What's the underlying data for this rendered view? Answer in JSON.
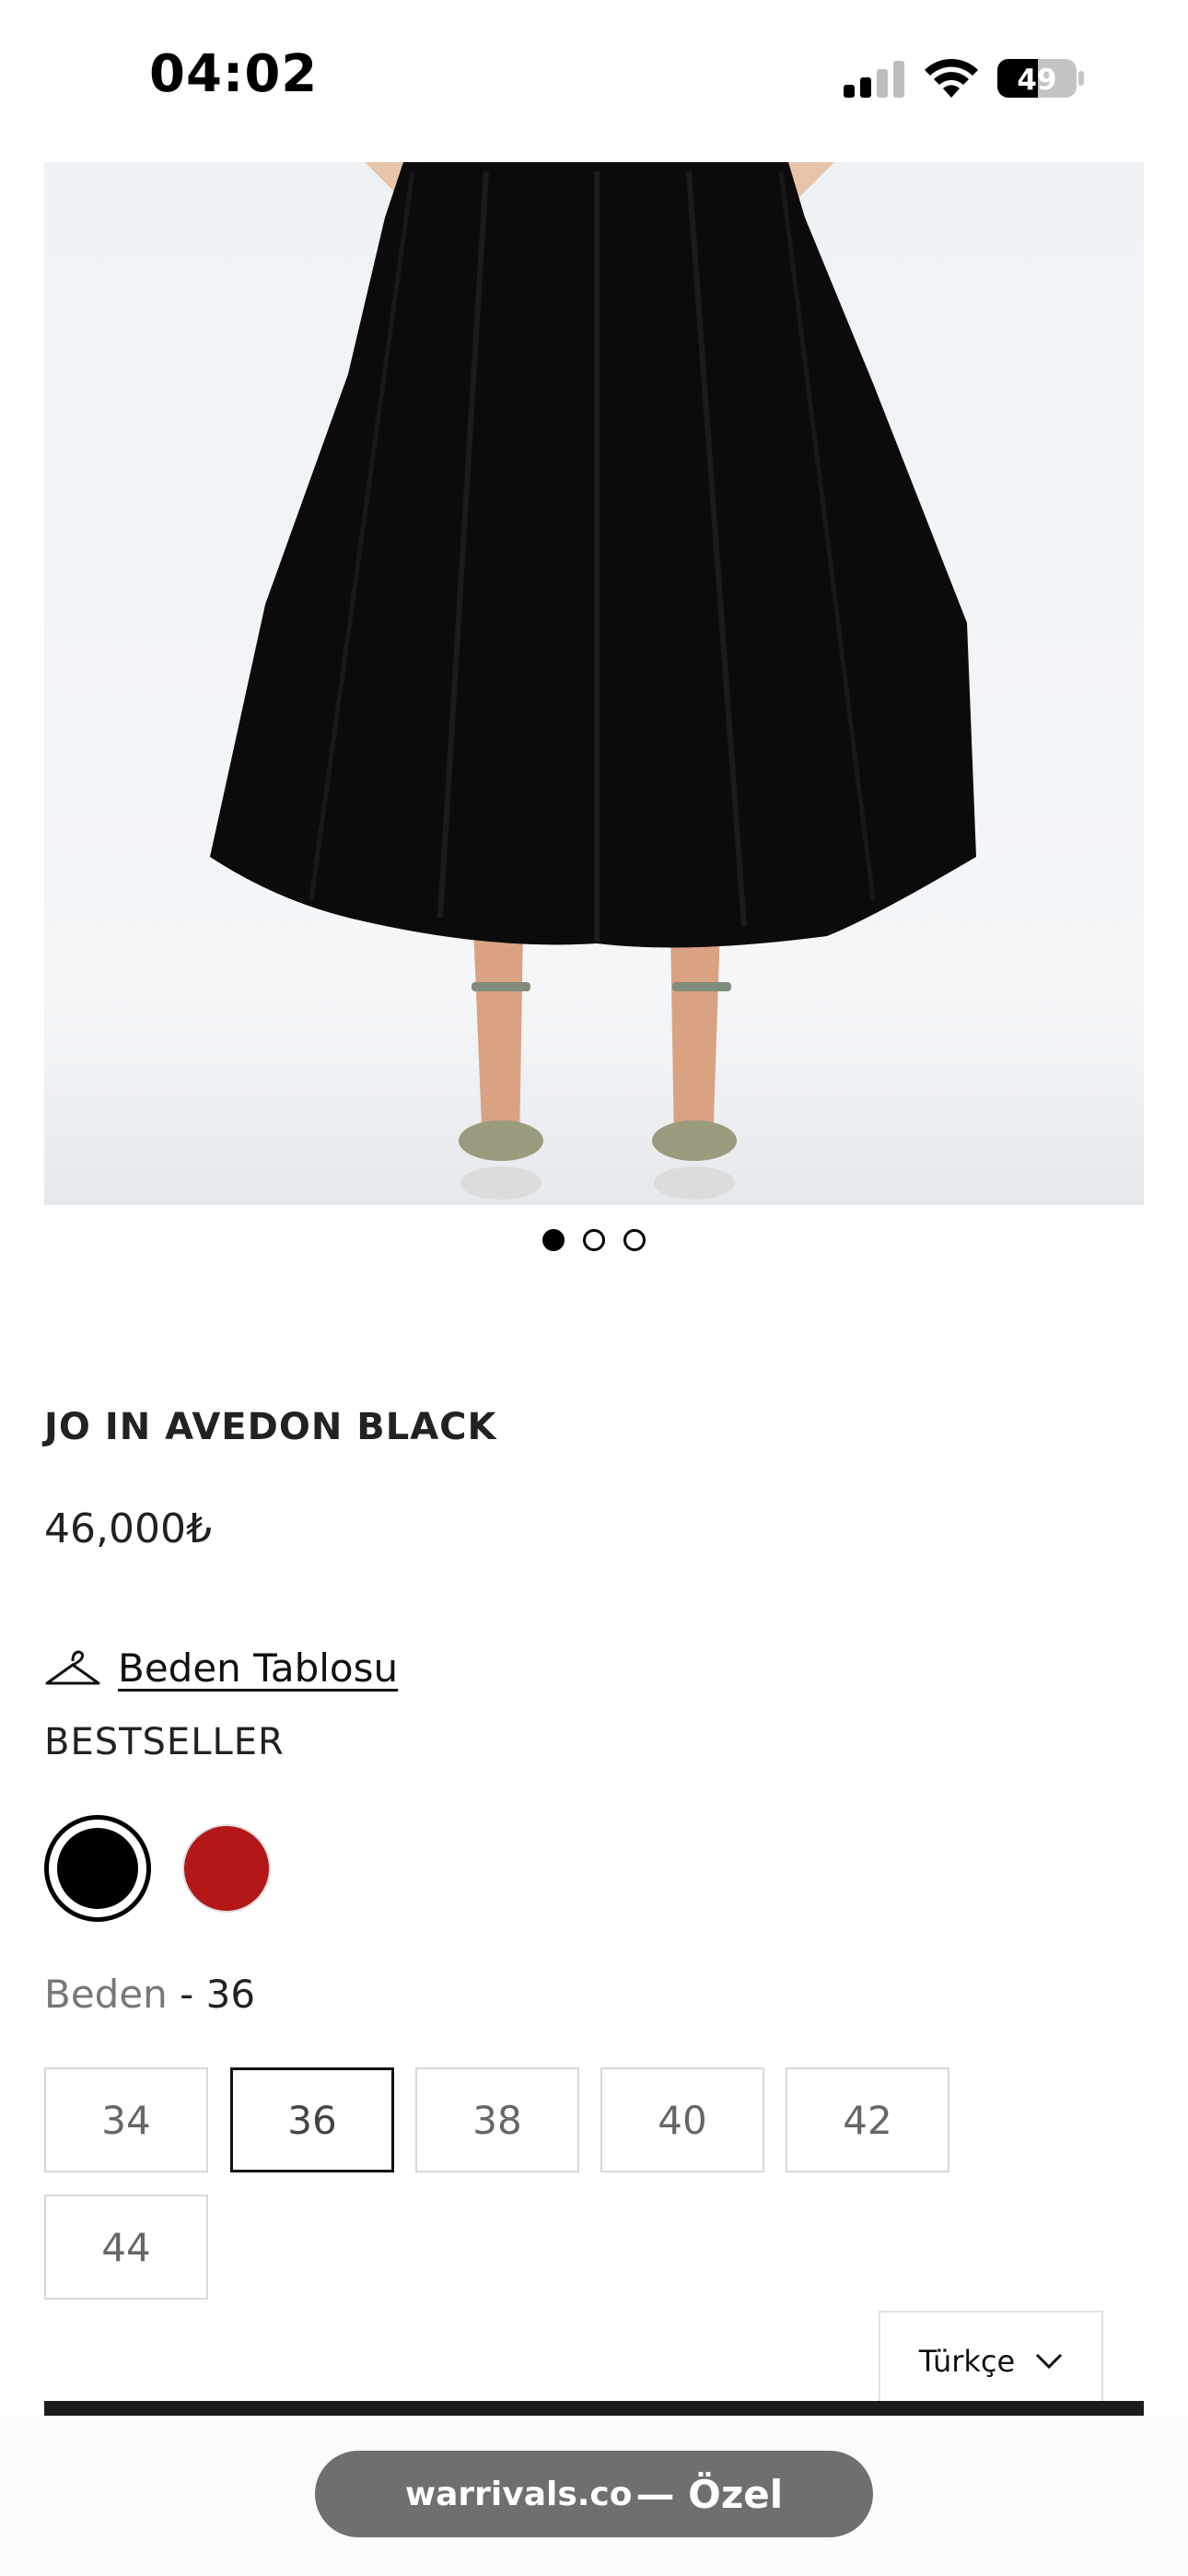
{
  "status_bar": {
    "time": "04:02",
    "battery": "49"
  },
  "gallery": {
    "image_alt": "Black pleated midi skirt with embellished heeled sandals",
    "dots": [
      "active",
      "",
      ""
    ]
  },
  "product": {
    "title": "JO IN AVEDON BLACK",
    "price": "46,000₺",
    "size_chart_label": "Beden Tablosu",
    "badge": "BESTSELLER",
    "colors": [
      {
        "name": "black",
        "hex": "#000000",
        "selected": true
      },
      {
        "name": "red",
        "hex": "#b31718",
        "selected": false
      }
    ],
    "size_label": "Beden",
    "size_sep": " - ",
    "size_selected": "36",
    "sizes": [
      "34",
      "36",
      "38",
      "40",
      "42",
      "44"
    ]
  },
  "language": {
    "label": "Türkçe"
  },
  "browser": {
    "url": "warrivals.co",
    "suffix": " — Özel"
  }
}
